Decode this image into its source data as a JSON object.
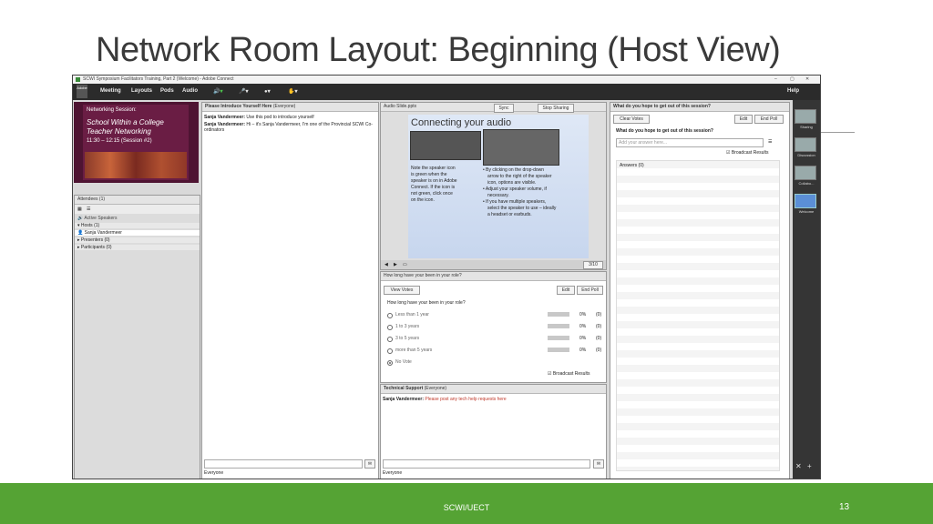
{
  "slide": {
    "title": "Network Room Layout: Beginning (Host View)",
    "footer": "SCWI/UECT",
    "page_number": "13"
  },
  "window": {
    "title": "SCWI Symposium Facilitators Training, Part 2 (Welcome) - Adobe Connect",
    "help": "Help"
  },
  "menu": {
    "logo": "Adobe",
    "items": [
      "Meeting",
      "Layouts",
      "Pods",
      "Audio"
    ]
  },
  "share": {
    "line1": "Networking Session:",
    "line2": "School Within a College",
    "line3": "Teacher Networking",
    "line4": "11:30 – 12:15 (Session #2)"
  },
  "attendees": {
    "header": "Attendees",
    "count": "(1)",
    "active_speakers": "Active Speakers",
    "hosts": "Hosts (1)",
    "host_name": "Sanja Vandermeer",
    "presenters": "Presenters (0)",
    "participants": "Participants (0)"
  },
  "chat_intro": {
    "header": "Please Introduce Yourself Here",
    "header_sub": "(Everyone)",
    "msg1_name": "Sanja Vandermeer:",
    "msg1_text": "Use this pod to introduce yourself",
    "msg2_name": "Sanja Vandermeer:",
    "msg2_text": "Hi – it's Sanja Vandermeer, I'm one of the Provincial SCWI Co-",
    "msg2_text2": "ordinators",
    "footer": "Everyone"
  },
  "audio_slide": {
    "header": "Audio Slide.pptx",
    "sync": "Sync",
    "stop_sharing": "Stop Sharing",
    "slide_title": "Connecting your audio",
    "left_text": [
      "Note the speaker icon",
      "is green when the",
      "speaker is on in Adobe",
      "Connect. If the icon is",
      "not green, click once",
      "on the icon."
    ],
    "bullets": [
      "By clicking on the drop-down",
      "arrow to the right of the speaker",
      "icon, options are visible.",
      "Adjust your speaker volume, if",
      "necessary.",
      "If you have multiple speakers,",
      "select the speaker to use – ideally",
      "a headset or earbuds."
    ],
    "page": "3/10"
  },
  "poll": {
    "header": "How long have your been in your role?",
    "view_votes": "View Votes",
    "edit": "Edit",
    "end_poll": "End Poll",
    "question": "How long have your been in your role?",
    "options": [
      {
        "label": "Less than 1 year",
        "pct": "0%",
        "count": "(0)"
      },
      {
        "label": "1 to 3 years",
        "pct": "0%",
        "count": "(0)"
      },
      {
        "label": "3 to 5 years",
        "pct": "0%",
        "count": "(0)"
      },
      {
        "label": "more than 5 years",
        "pct": "0%",
        "count": "(0)"
      },
      {
        "label": "No Vote",
        "pct": "",
        "count": ""
      }
    ],
    "broadcast": "Broadcast Results"
  },
  "tech": {
    "header": "Technical Support",
    "header_sub": "(Everyone)",
    "name": "Sanja Vandermeer:",
    "text": "Please post any tech help requests here",
    "footer": "Everyone"
  },
  "qa": {
    "header": "What do you hope to get out of this session?",
    "clear_votes": "Clear Votes",
    "edit": "Edit",
    "end_poll": "End Poll",
    "question": "What do you hope to get out of this session?",
    "placeholder": "Add your answer here...",
    "broadcast": "Broadcast Results",
    "answers": "Answers (0)"
  },
  "layouts": {
    "items": [
      "Sharing",
      "Discussion",
      "Collabo...",
      "Welcome"
    ]
  },
  "colors": {
    "footer_green": "#55a334",
    "footer_light_green": "#8ac149",
    "share_bg": "#5a1a3a"
  }
}
